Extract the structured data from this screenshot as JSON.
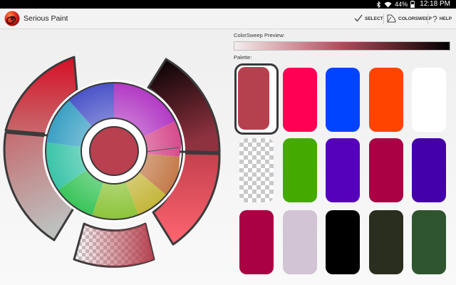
{
  "status_bar": {
    "battery_percent": "44%",
    "time": "12:18 PM"
  },
  "app": {
    "title": "Serious Paint",
    "logo_icon": "spiral-logo-icon"
  },
  "actions": {
    "select_label": "SELECT",
    "colorsweep_label": "COLORSWEEP",
    "help_label": "HELP"
  },
  "panel": {
    "preview_label": "ColorSweep Preview:",
    "palette_label": "Palette:",
    "preview_gradient": [
      "#f4eeee",
      "#b5485a",
      "#000000"
    ]
  },
  "current_color": "#b8404f",
  "palette": [
    {
      "color": "#b5414f",
      "selected": true
    },
    {
      "color": "#ff0055"
    },
    {
      "color": "#0044ff"
    },
    {
      "color": "#ff4400"
    },
    {
      "color": "#ffffff"
    },
    {
      "color": "transparent",
      "checker": true
    },
    {
      "color": "#44aa00"
    },
    {
      "color": "#5500bb"
    },
    {
      "color": "#aa0044"
    },
    {
      "color": "#4400aa"
    },
    {
      "color": "#aa0044"
    },
    {
      "color": "#d2c4d4"
    },
    {
      "color": "#000000"
    },
    {
      "color": "#2a2e1e"
    },
    {
      "color": "#2e5530"
    }
  ]
}
